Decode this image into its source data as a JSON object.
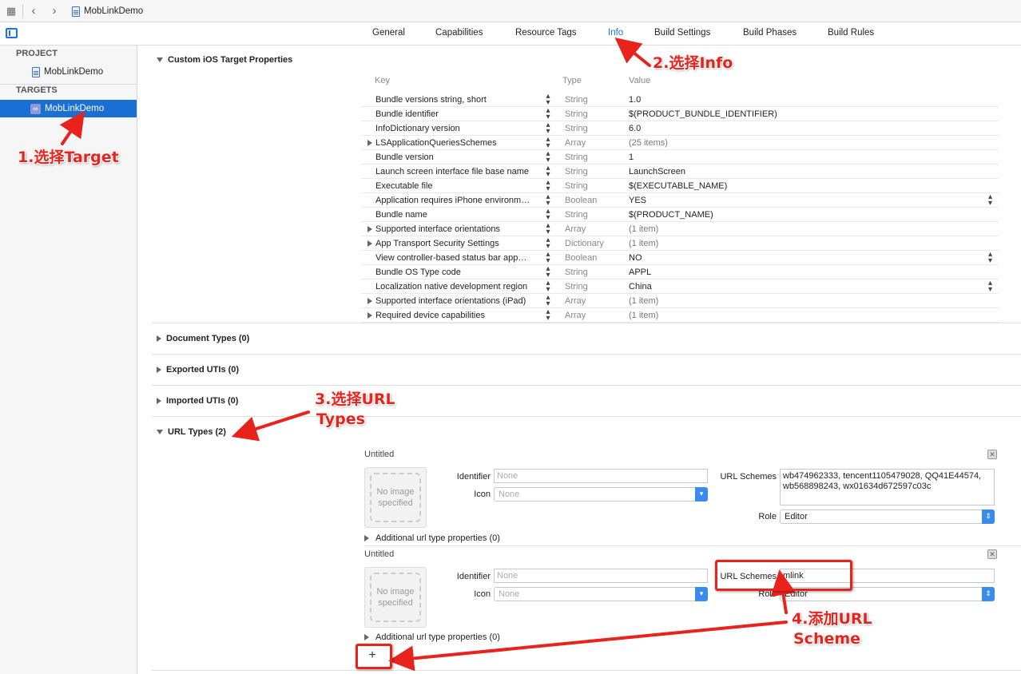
{
  "toolbar": {
    "project_name": "MobLinkDemo"
  },
  "tabs": [
    {
      "label": "General",
      "active": false
    },
    {
      "label": "Capabilities",
      "active": false
    },
    {
      "label": "Resource Tags",
      "active": false
    },
    {
      "label": "Info",
      "active": true
    },
    {
      "label": "Build Settings",
      "active": false
    },
    {
      "label": "Build Phases",
      "active": false
    },
    {
      "label": "Build Rules",
      "active": false
    }
  ],
  "sidebar": {
    "project_header": "PROJECT",
    "project_item": "MobLinkDemo",
    "targets_header": "TARGETS",
    "target_item": "MobLinkDemo"
  },
  "custom_props": {
    "title": "Custom iOS Target Properties",
    "col_key": "Key",
    "col_type": "Type",
    "col_value": "Value",
    "rows": [
      {
        "key": "Bundle versions string, short",
        "type": "String",
        "value": "1.0"
      },
      {
        "key": "Bundle identifier",
        "type": "String",
        "value": "$(PRODUCT_BUNDLE_IDENTIFIER)"
      },
      {
        "key": "InfoDictionary version",
        "type": "String",
        "value": "6.0"
      },
      {
        "key": "LSApplicationQueriesSchemes",
        "type": "Array",
        "value": "(25 items)"
      },
      {
        "key": "Bundle version",
        "type": "String",
        "value": "1"
      },
      {
        "key": "Launch screen interface file base name",
        "type": "String",
        "value": "LaunchScreen"
      },
      {
        "key": "Executable file",
        "type": "String",
        "value": "$(EXECUTABLE_NAME)"
      },
      {
        "key": "Application requires iPhone environm…",
        "type": "Boolean",
        "value": "YES"
      },
      {
        "key": "Bundle name",
        "type": "String",
        "value": "$(PRODUCT_NAME)"
      },
      {
        "key": "Supported interface orientations",
        "type": "Array",
        "value": "(1 item)"
      },
      {
        "key": "App Transport Security Settings",
        "type": "Dictionary",
        "value": "(1 item)"
      },
      {
        "key": "View controller-based status bar app…",
        "type": "Boolean",
        "value": "NO"
      },
      {
        "key": "Bundle OS Type code",
        "type": "String",
        "value": "APPL"
      },
      {
        "key": "Localization native development region",
        "type": "String",
        "value": "China"
      },
      {
        "key": "Supported interface orientations (iPad)",
        "type": "Array",
        "value": "(1 item)"
      },
      {
        "key": "Required device capabilities",
        "type": "Array",
        "value": "(1 item)"
      }
    ]
  },
  "sections": {
    "document_types": "Document Types (0)",
    "exported_utis": "Exported UTIs (0)",
    "imported_utis": "Imported UTIs (0)",
    "url_types": "URL Types (2)"
  },
  "url_types": [
    {
      "title": "Untitled",
      "no_image_text": "No image specified",
      "identifier_label": "Identifier",
      "identifier_placeholder": "None",
      "icon_label": "Icon",
      "icon_placeholder": "None",
      "schemes_label": "URL Schemes",
      "schemes_value": "wb474962333, tencent1105479028, QQ41E44574, wb568898243, wx01634d672597c03c",
      "role_label": "Role",
      "role_value": "Editor",
      "additional": "Additional url type properties (0)"
    },
    {
      "title": "Untitled",
      "no_image_text": "No image specified",
      "identifier_label": "Identifier",
      "identifier_placeholder": "None",
      "icon_label": "Icon",
      "icon_placeholder": "None",
      "schemes_label": "URL Schemes",
      "schemes_value": "mlink",
      "role_label": "Role",
      "role_value": "Editor",
      "additional": "Additional url type properties (0)"
    }
  ],
  "add_button": "+",
  "annotations": {
    "a1": "1.选择Target",
    "a2": "2.选择Info",
    "a3_line1": "3.选择URL",
    "a3_line2": "Types",
    "a4_line1": "4.添加URL",
    "a4_line2": "Scheme"
  },
  "colors": {
    "accent": "#1a73e8",
    "annotation": "#e8231c",
    "selection": "#1a6fd4"
  }
}
